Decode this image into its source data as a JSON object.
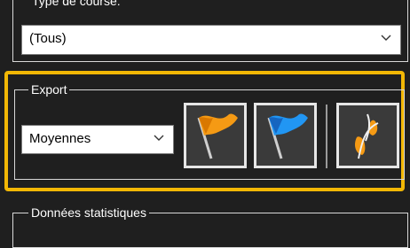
{
  "course_type": {
    "legend": "Type de course:",
    "selected": "(Tous)"
  },
  "export": {
    "legend": "Export",
    "select_value": "Moyennes",
    "buttons": [
      {
        "icon": "orange-flag-icon",
        "color": "#f59a14"
      },
      {
        "icon": "blue-flag-icon",
        "color": "#2196f3"
      },
      {
        "icon": "footsteps-icon",
        "color": "#f59a14"
      }
    ]
  },
  "stats": {
    "legend": "Données statistiques"
  },
  "colors": {
    "highlight": "#f2b705",
    "background": "#1f1f1f"
  }
}
